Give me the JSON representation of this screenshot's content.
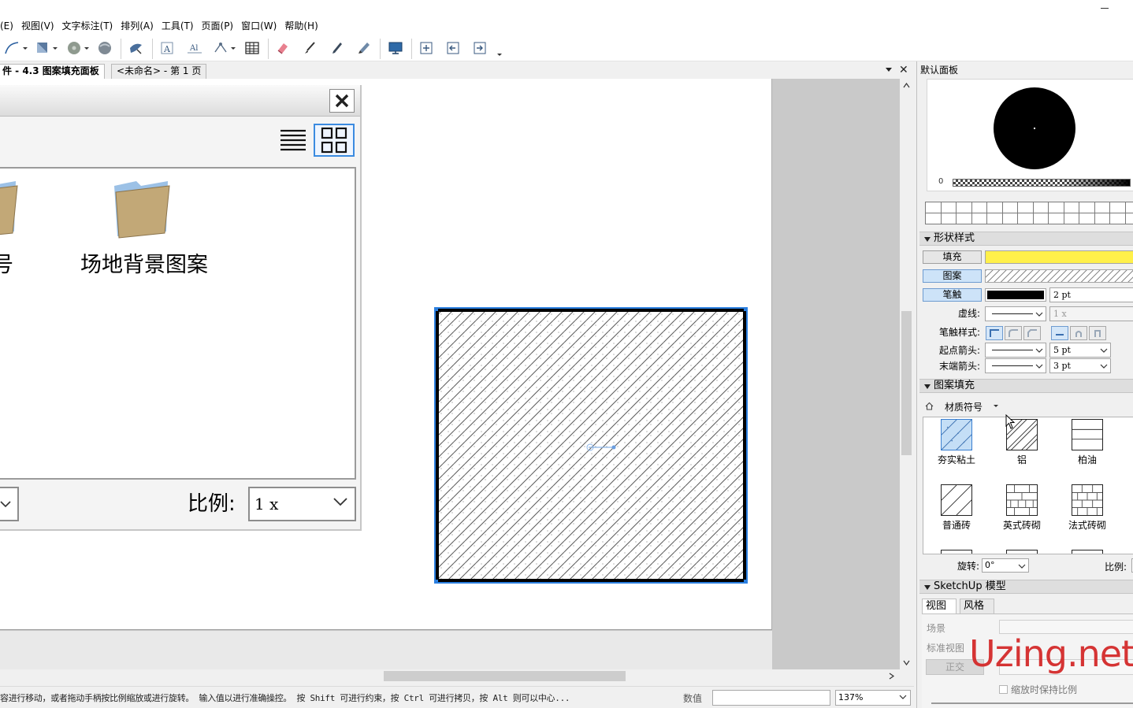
{
  "menubar": {
    "items": [
      "(E)",
      "视图(V)",
      "文字标注(T)",
      "排列(A)",
      "工具(T)",
      "页面(P)",
      "窗口(W)",
      "帮助(H)"
    ]
  },
  "toolbar": {
    "icons": [
      "pen-tool-icon",
      "fill-tool-icon",
      "color-disc-icon",
      "material-ball-icon",
      "eye-dropper-bird-icon",
      "text-tool-icon",
      "text-frame-icon",
      "flip-tool-icon",
      "table-icon",
      "eraser-icon",
      "brush-icon",
      "pen-icon",
      "pattern-pen-icon",
      "presentation-icon",
      "insert-page-icon",
      "prev-page-icon",
      "next-page-icon"
    ]
  },
  "doc_tabs": {
    "active": "件 - 4.3 图案填充面板",
    "inactive": "<未命名> - 第 1 页"
  },
  "pattern_dialog": {
    "folders": [
      {
        "label": "符号"
      },
      {
        "label": "场地背景图案"
      }
    ],
    "scale_label": "比例:",
    "scale_value": "1 x"
  },
  "status_bar": {
    "hint": "容进行移动，或者拖动手柄按比例缩放或进行旋转。 输入值以进行准确操控。 按 Shift 可进行约束，按 Ctrl 可进行拷贝，按 Alt 则可以中心...",
    "value_label": "数值",
    "zoom": "137%"
  },
  "dock": {
    "title": "默认面板",
    "opacity_min": "0",
    "shape_style": {
      "header": "形状样式",
      "fill_label": "填充",
      "pattern_label": "图案",
      "stroke_label": "笔触",
      "stroke_width": "2 pt",
      "dash_label": "虚线:",
      "dash_scale": "1 x",
      "stroke_style_label": "笔触样式:",
      "start_arrow_label": "起点箭头:",
      "start_arrow_size": "5 pt",
      "end_arrow_label": "末端箭头:",
      "end_arrow_size": "3 pt",
      "fill_color": "#fff04a",
      "stroke_color": "#000000"
    },
    "pattern_fill": {
      "header": "图案填充",
      "category": "材质符号",
      "items": [
        {
          "label": "夯实粘土",
          "selected": true
        },
        {
          "label": "铝",
          "selected": false
        },
        {
          "label": "柏油",
          "selected": false
        },
        {
          "label": "普通砖",
          "selected": false
        },
        {
          "label": "英式砖砌",
          "selected": false
        },
        {
          "label": "法式砖砌",
          "selected": false
        }
      ],
      "rotation_label": "旋转:",
      "rotation_value": "0°",
      "ratio_label": "比例:"
    },
    "sketchup": {
      "header": "SketchUp 模型",
      "tab_view": "视图",
      "tab_style": "风格",
      "scene_label": "场景",
      "standard_view_label": "标准视图",
      "front_button": "正交",
      "keep_ratio_label": "缩放时保持比例"
    }
  },
  "watermark": "Uzing.net",
  "colors": {
    "selection_blue": "#2b7fe0",
    "fill_yellow": "#fff04a",
    "watermark_red": "#d42a2a"
  }
}
